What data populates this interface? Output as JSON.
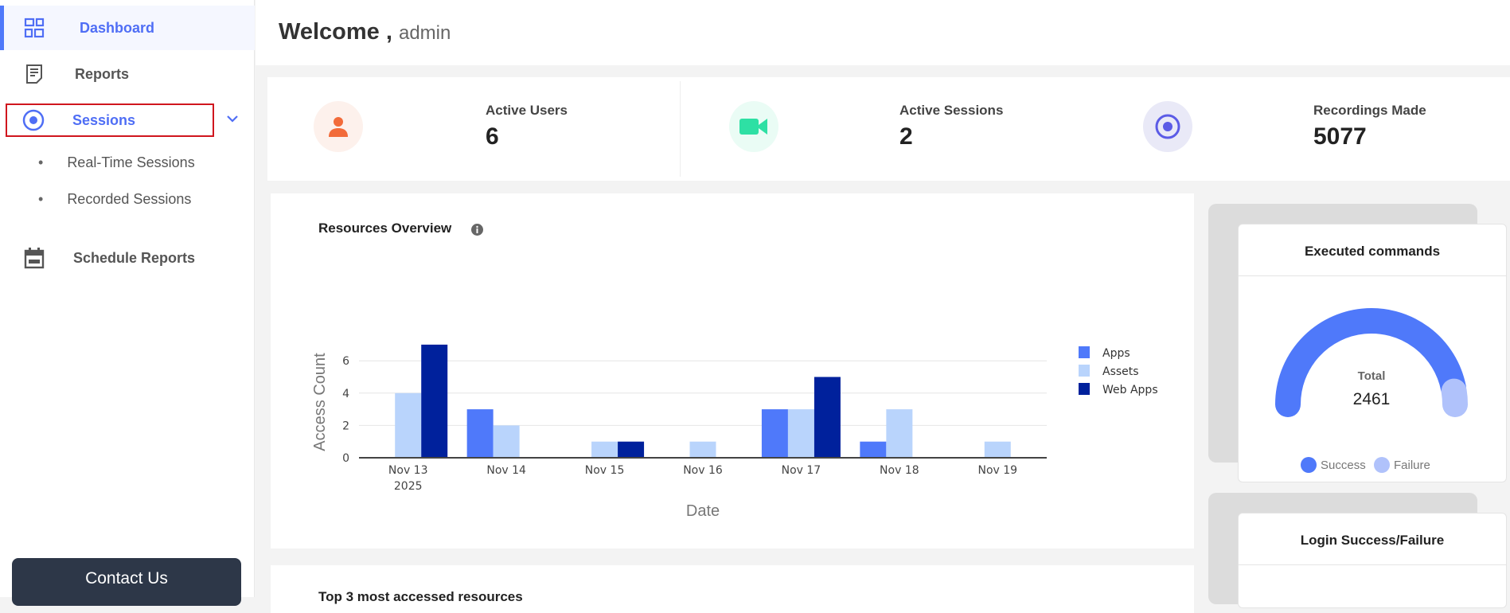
{
  "sidebar": {
    "items": [
      {
        "label": "Dashboard",
        "icon": "dashboard-grid-icon",
        "active": true
      },
      {
        "label": "Reports",
        "icon": "report-document-icon"
      },
      {
        "label": "Sessions",
        "icon": "record-circle-icon",
        "expanded": true
      },
      {
        "label": "Schedule Reports",
        "icon": "calendar-icon"
      }
    ],
    "sub_items": [
      "Real-Time Sessions",
      "Recorded Sessions"
    ],
    "contact_label": "Contact Us"
  },
  "header": {
    "welcome": "Welcome ,",
    "user": "admin"
  },
  "stats": [
    {
      "label": "Active Users",
      "value": "6",
      "icon": "user-icon",
      "color": "#f26b3a"
    },
    {
      "label": "Active Sessions",
      "value": "2",
      "icon": "video-camera-icon",
      "color": "#2ee0a4"
    },
    {
      "label": "Recordings Made",
      "value": "5077",
      "icon": "record-circle-icon",
      "color": "#5b5be6"
    }
  ],
  "resources": {
    "title": "Resources Overview"
  },
  "chart_data": [
    {
      "type": "bar",
      "title": "Resources Overview",
      "xlabel": "Date",
      "ylabel": "Access Count",
      "categories": [
        "Nov 13\n2025",
        "Nov 14",
        "Nov 15",
        "Nov 16",
        "Nov 17",
        "Nov 18",
        "Nov 19"
      ],
      "yticks": [
        0,
        2,
        4,
        6
      ],
      "ylim": [
        0,
        7
      ],
      "grid": true,
      "legend": "right",
      "series": [
        {
          "name": "Apps",
          "color": "#4f79fa",
          "values": [
            0,
            3,
            0,
            0,
            3,
            1,
            0
          ]
        },
        {
          "name": "Assets",
          "color": "#b9d4fc",
          "values": [
            4,
            2,
            1,
            1,
            3,
            3,
            1
          ]
        },
        {
          "name": "Web Apps",
          "color": "#00219c",
          "values": [
            7,
            0,
            1,
            0,
            5,
            0,
            0
          ]
        }
      ]
    },
    {
      "type": "pie",
      "title": "Executed commands",
      "center_label": "Total",
      "total": "2461",
      "series": [
        {
          "name": "Success",
          "color": "#4f79fa",
          "share": 0.95
        },
        {
          "name": "Failure",
          "color": "#b0c2fb",
          "share": 0.05
        }
      ]
    }
  ],
  "login": {
    "title": "Login Success/Failure"
  },
  "top3": {
    "title": "Top 3 most accessed resources"
  }
}
